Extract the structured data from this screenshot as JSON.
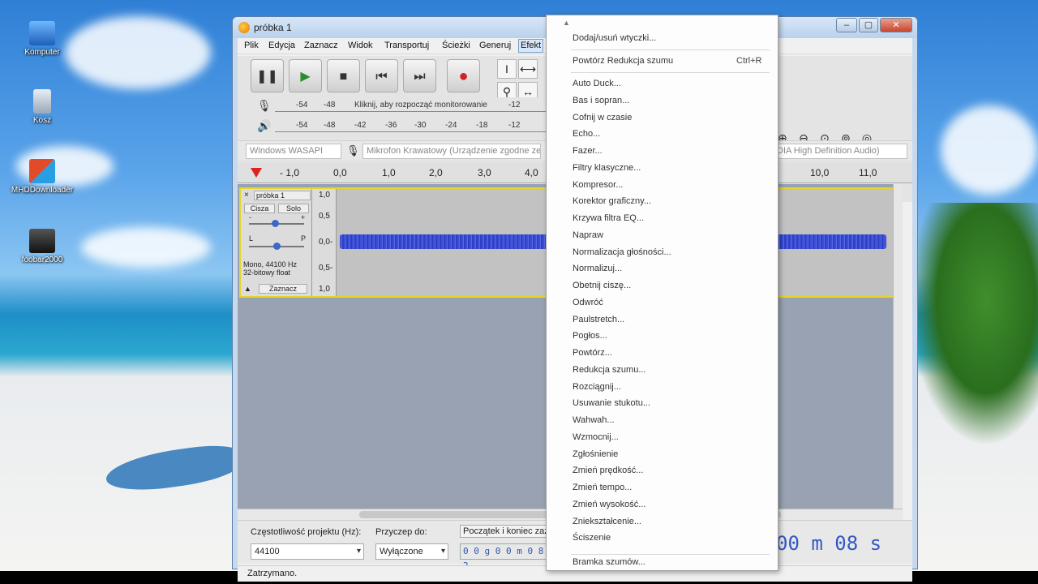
{
  "desktop": {
    "icons": [
      {
        "label": "Komputer"
      },
      {
        "label": "Kosz"
      },
      {
        "label": "MHDDownloader"
      },
      {
        "label": "foobar2000"
      }
    ]
  },
  "window": {
    "title": "próbka 1",
    "controls": {
      "minimize": "–",
      "maximize": "▢",
      "close": "✕"
    }
  },
  "menubar": {
    "items": [
      "Plik",
      "Edycja",
      "Zaznacz",
      "Widok",
      "Transportuj",
      "Ścieżki",
      "Generuj",
      "Efekt"
    ],
    "active": "Efekt"
  },
  "transport": {
    "pause": "❚❚",
    "play": "▶",
    "stop": "■",
    "skip_start": "⏮",
    "skip_end": "⏭",
    "record": "●"
  },
  "meters": {
    "record_hint": "Kliknij, aby rozpocząć monitorowanie",
    "record_scale": [
      "-54",
      "-48",
      "-12"
    ],
    "playback_scale": [
      "-54",
      "-48",
      "-42",
      "-36",
      "-30",
      "-24",
      "-18",
      "-12"
    ]
  },
  "devices": {
    "host": "Windows WASAPI",
    "input": "Mikrofon Krawatowy (Urządzenie zgodne ze",
    "output": "DIA High Definition Audio)"
  },
  "ruler": {
    "ticks_left": [
      "- 1,0",
      "0,0",
      "1,0",
      "2,0",
      "3,0",
      "4,0"
    ],
    "ticks_right": [
      "10,0",
      "11,0"
    ]
  },
  "track": {
    "name": "próbka 1",
    "mute": "Cisza",
    "solo": "Solo",
    "gain_minus": "-",
    "gain_plus": "+",
    "pan_left": "L",
    "pan_right": "P",
    "info_line1": "Mono, 44100 Hz",
    "info_line2": "32-bitowy float",
    "select": "Zaznacz",
    "vscale": [
      "1,0",
      "0,5",
      "0,0-",
      "0,5-",
      "1,0"
    ]
  },
  "selection_bar": {
    "rate_label": "Częstotliwość projektu (Hz):",
    "rate_value": "44100",
    "snap_label": "Przyczep do:",
    "snap_value": "Wyłączone",
    "range_label": "Początek i koniec zaz",
    "time_value": "0 0 g 0 0 m 0 8 2",
    "big_time": "00 m 08 s"
  },
  "status": {
    "text": "Zatrzymano."
  },
  "effect_menu": {
    "top": [
      {
        "label": "Dodaj/usuń wtyczki..."
      },
      {
        "label": "Powtórz Redukcja szumu",
        "shortcut": "Ctrl+R"
      }
    ],
    "items": [
      "Auto Duck...",
      "Bas i sopran...",
      "Cofnij w czasie",
      "Echo...",
      "Fazer...",
      "Filtry klasyczne...",
      "Kompresor...",
      "Korektor graficzny...",
      "Krzywa filtra EQ...",
      "Napraw",
      "Normalizacja głośności...",
      "Normalizuj...",
      "Obetnij ciszę...",
      "Odwróć",
      "Paulstretch...",
      "Pogłos...",
      "Powtórz...",
      "Redukcja szumu...",
      "Rozciągnij...",
      "Usuwanie stukotu...",
      "Wahwah...",
      "Wzmocnij...",
      "Zgłośnienie",
      "Zmień prędkość...",
      "Zmień tempo...",
      "Zmień wysokość...",
      "Zniekształcenie...",
      "Ściszenie"
    ],
    "bottom": [
      {
        "label": "Bramka szumów..."
      }
    ]
  }
}
